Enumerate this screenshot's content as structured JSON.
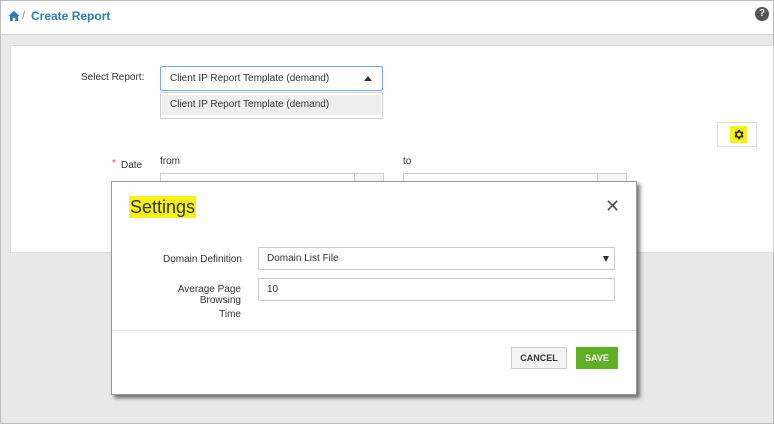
{
  "header": {
    "breadcrumb_separator": "/",
    "title": "Create Report",
    "help_icon": "?"
  },
  "form": {
    "select_report_label": "Select Report:",
    "select_report_value": "Client IP Report Template (demand)",
    "dropdown_options": [
      "Client IP Report Template (demand)"
    ],
    "date_required_mark": "*",
    "date_label": "Date",
    "from_label": "from",
    "to_label": "to"
  },
  "settings_modal": {
    "title": "Settings",
    "close_icon": "✕",
    "domain_definition_label": "Domain Definition",
    "domain_definition_value": "Domain List File",
    "avg_page_browsing_label_line1": "Average Page Browsing",
    "avg_page_browsing_label_line2": "Time",
    "avg_page_browsing_value": "10",
    "cancel_label": "CANCEL",
    "save_label": "SAVE"
  },
  "colors": {
    "link_blue": "#2d7ac0",
    "highlight_yellow": "#f6f216",
    "save_green": "#5cb021",
    "required_red": "#d9534f"
  },
  "icons": [
    "home-icon",
    "help-icon",
    "gear-icon",
    "close-icon",
    "caret-up-icon",
    "caret-down-icon"
  ]
}
